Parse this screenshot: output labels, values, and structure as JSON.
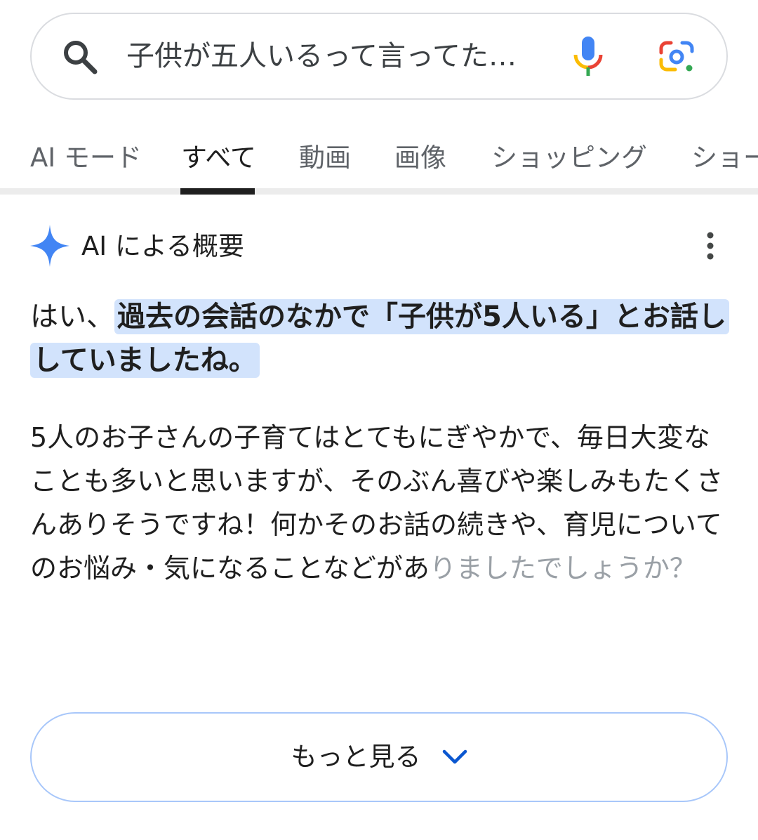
{
  "search": {
    "query": "子供が五人いるって言ってた…"
  },
  "tabs": [
    {
      "label": "AI モード"
    },
    {
      "label": "すべて",
      "active": true
    },
    {
      "label": "動画"
    },
    {
      "label": "画像"
    },
    {
      "label": "ショッピング"
    },
    {
      "label": "ショー"
    }
  ],
  "ai_overview": {
    "title": "AI による概要",
    "lead_plain": "はい、",
    "lead_highlight": "過去の会話のなかで「子供が5人いる」とお話ししていましたね。",
    "body": "5人のお子さんの子育てはとてもにぎやかで、毎日大変なことも多いと思いますが、そのぶん喜びや楽しみもたくさんありそうですね！何かそのお話の続きや、育児についてのお悩み・気になることなどがあ",
    "body_faded": "りましたでしょうか？",
    "more_label": "もっと見る"
  },
  "colors": {
    "highlight": "#d2e3fc",
    "active_tab": "#1f1f1f",
    "sparkle": "#4285f4",
    "button_border": "#a8c7fa"
  }
}
